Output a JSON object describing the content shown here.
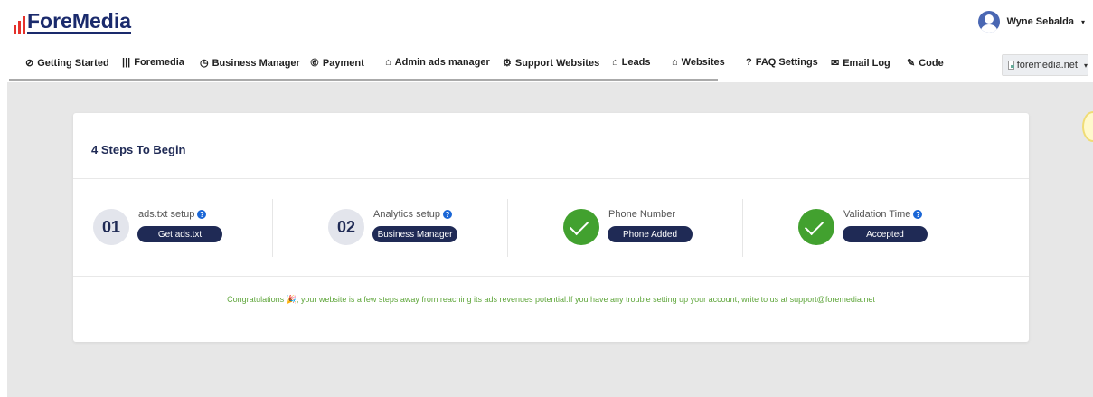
{
  "header": {
    "logo_text": "ForeMedia",
    "user_name": "Wyne Sebalda",
    "user_caret": "▾"
  },
  "nav": {
    "items": [
      {
        "label": "Getting Started",
        "icon": "⊘"
      },
      {
        "label": "Foremedia",
        "icon": "|||"
      },
      {
        "label": "Business Manager",
        "icon": "◷"
      },
      {
        "label": "Payment",
        "icon": "⑥"
      },
      {
        "label": "Admin ads manager",
        "icon": "⌂"
      },
      {
        "label": "Support Websites",
        "icon": "⚙"
      },
      {
        "label": "Leads",
        "icon": "⌂"
      },
      {
        "label": "Websites",
        "icon": "⌂"
      },
      {
        "label": "FAQ Settings",
        "icon": "?"
      },
      {
        "label": "Email Log",
        "icon": "✉"
      },
      {
        "label": "Code",
        "icon": "✎"
      }
    ],
    "site_select": "foremedia.net",
    "site_caret": "▾"
  },
  "card": {
    "title": "4 Steps To Begin",
    "steps": [
      {
        "number": "01",
        "label": "ads.txt setup",
        "help": "?",
        "button": "Get ads.txt"
      },
      {
        "number": "02",
        "label": "Analytics setup",
        "help": "?",
        "button": "Business Manager"
      },
      {
        "label": "Phone Number",
        "button": "Phone Added"
      },
      {
        "label": "Validation Time",
        "help": "?",
        "button": "Accepted"
      }
    ],
    "congrats": "Congratulations 🎉, your website is a few steps away from reaching its ads revenues potential.If you have any trouble setting up your account, write to us at support@foremedia.net"
  },
  "colors": {
    "brand_navy": "#1f2a55",
    "logo_red": "#e4312b",
    "success_green": "#42a12f",
    "congrats_green": "#5fa63b",
    "help_blue": "#1a66d6"
  }
}
